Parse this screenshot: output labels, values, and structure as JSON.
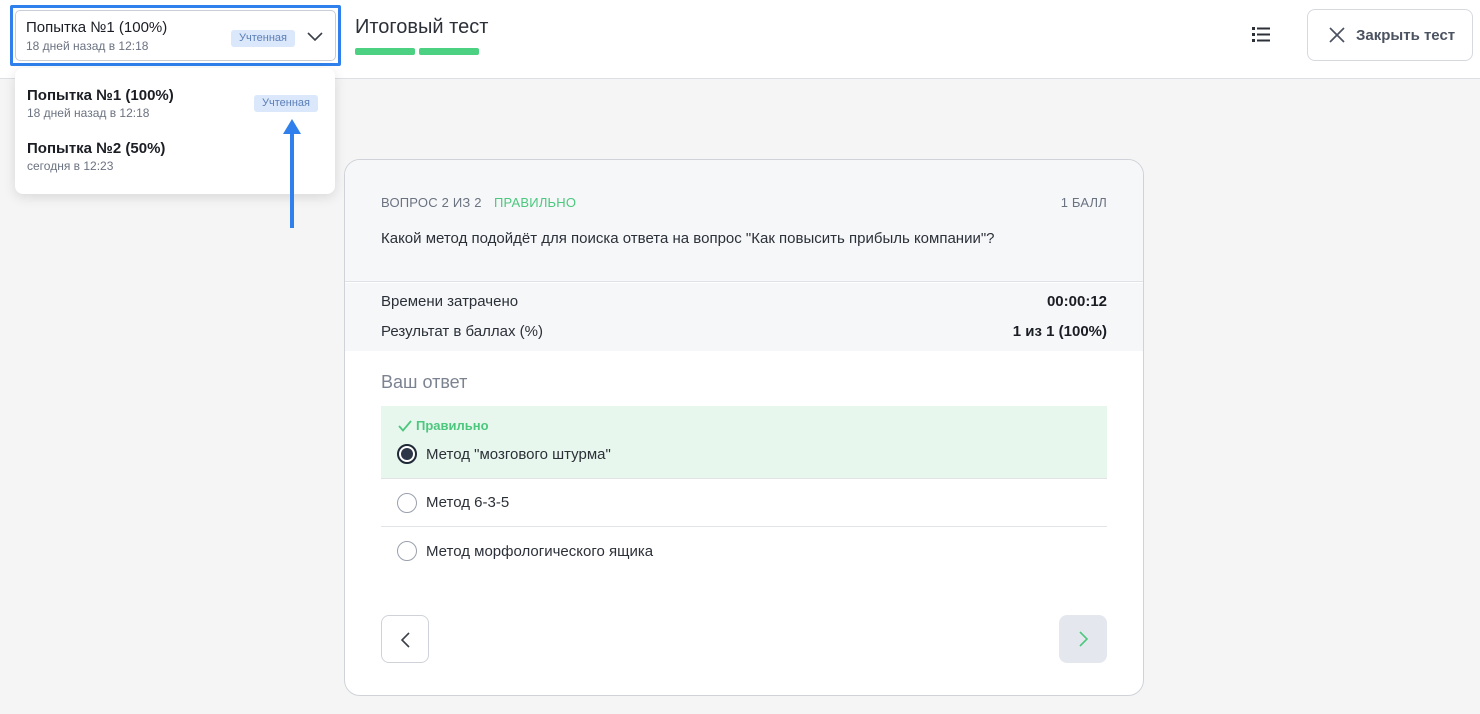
{
  "header": {
    "selected_attempt": {
      "title": "Попытка №1 (100%)",
      "subtitle": "18 дней назад в 12:18",
      "badge": "Учтенная"
    },
    "page_title": "Итоговый тест",
    "progress_segments": 2,
    "close_button": "Закрыть тест"
  },
  "attempts_dropdown": [
    {
      "title": "Попытка №1 (100%)",
      "subtitle": "18 дней назад в 12:18",
      "badge": "Учтенная"
    },
    {
      "title": "Попытка №2 (50%)",
      "subtitle": "сегодня в 12:23"
    }
  ],
  "question": {
    "counter": "ВОПРОС 2 ИЗ 2",
    "status": "ПРАВИЛЬНО",
    "points": "1 БАЛЛ",
    "text": "Какой метод подойдёт для поиска ответа на вопрос \"Как повысить прибыль компании\"?"
  },
  "stats": {
    "time_label": "Времени затрачено",
    "time_value": "00:00:12",
    "score_label": "Результат в баллах (%)",
    "score_value": "1 из 1 (100%)"
  },
  "answer": {
    "heading": "Ваш ответ",
    "correct_tag": "Правильно",
    "options": [
      {
        "label": "Метод \"мозгового штурма\"",
        "selected": true,
        "correct": true
      },
      {
        "label": "Метод 6-3-5",
        "selected": false
      },
      {
        "label": "Метод морфологического ящика",
        "selected": false
      }
    ]
  },
  "colors": {
    "accent_blue": "#2f80ed",
    "success_green": "#4cc77e",
    "progress_green": "#4cd182",
    "badge_bg": "#dbe7fb"
  },
  "icons": [
    "chevron-down-icon",
    "list-icon",
    "close-icon",
    "check-icon",
    "arrow-up-icon",
    "chevron-left-icon",
    "chevron-right-icon"
  ]
}
